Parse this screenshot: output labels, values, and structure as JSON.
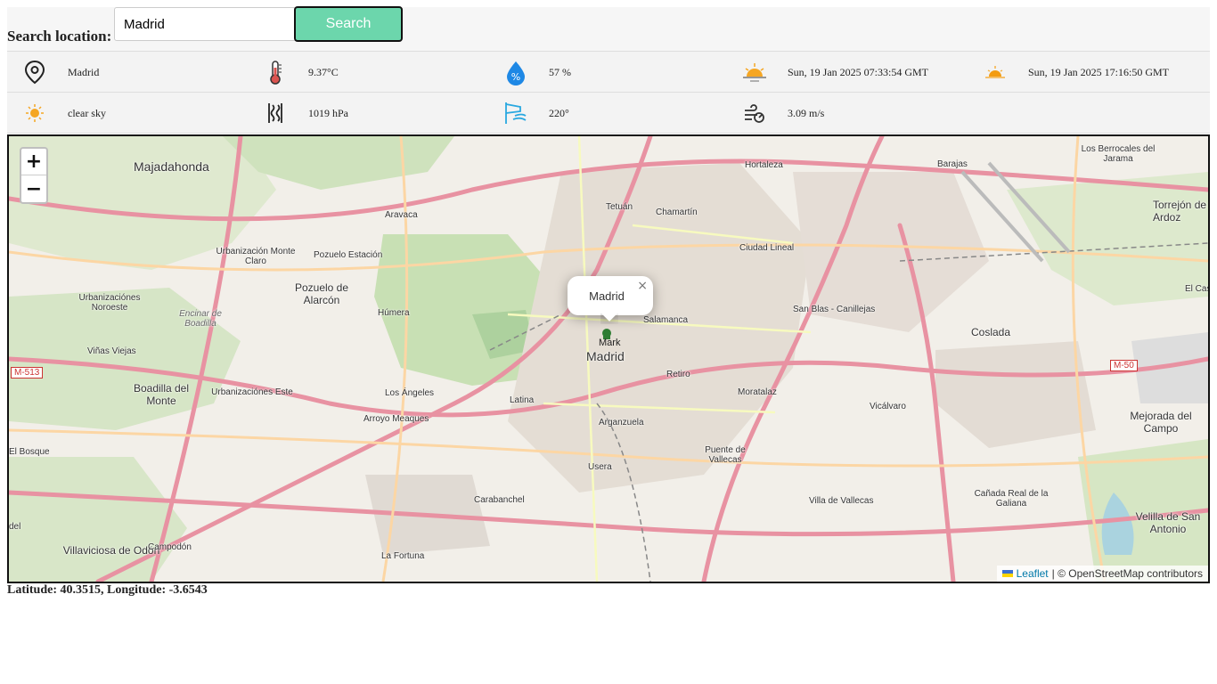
{
  "search": {
    "label": "Search location:",
    "value": "Madrid",
    "button_label": "Search"
  },
  "weather": {
    "location": "Madrid",
    "temperature": "9.37°C",
    "humidity": "57 %",
    "sunrise": "Sun, 19 Jan 2025 07:33:54 GMT",
    "sunset": "Sun, 19 Jan 2025 17:16:50 GMT",
    "description": "clear sky",
    "pressure": "1019 hPa",
    "wind_direction": "220°",
    "wind_speed": "3.09 m/s"
  },
  "icons": {
    "location": "location-pin-icon",
    "temperature": "thermometer-icon",
    "humidity": "humidity-icon",
    "sunrise": "sunrise-icon",
    "sunset": "sunset-icon",
    "description": "sun-icon",
    "pressure": "pressure-icon",
    "wind_direction": "wind-direction-icon",
    "wind_speed": "wind-speed-icon"
  },
  "map": {
    "zoom_in": "+",
    "zoom_out": "−",
    "popup_text": "Madrid",
    "popup_close": "×",
    "marker_label": "Mark",
    "attribution_leaflet": "Leaflet",
    "attribution_rest": "| © OpenStreetMap contributors",
    "places": {
      "majadahonda": "Majadahonda",
      "tetuan": "Tetuán",
      "chamartin": "Chamartín",
      "hortaleza": "Hortaleza",
      "barajas": "Barajas",
      "los_berrocales": "Los Berrocales del Jarama",
      "torrejon": "Torrejón de Ardoz",
      "aravaca": "Aravaca",
      "urb_monte_claro": "Urbanización Monte Claro",
      "pozuelo_estacion": "Pozuelo Estación",
      "ciudad_lineal": "Ciudad Lineal",
      "pozuelo": "Pozuelo de Alarcón",
      "urb_noroeste": "Urbanizaciónes Noroeste",
      "encinar": "Encinar de Boadilla",
      "humera": "Húmera",
      "salamanca": "Salamanca",
      "san_blas": "San Blas - Canillejas",
      "coslada": "Coslada",
      "madrid": "Madrid",
      "vinas_viejas": "Viñas Viejas",
      "retiro": "Retiro",
      "boadilla": "Boadilla del Monte",
      "urb_este": "Urbanizaciónes Este",
      "los_angeles": "Los Ángeles",
      "latina": "Latina",
      "moratalaz": "Moratalaz",
      "vicalvaro": "Vicálvaro",
      "arroyo_meaques": "Arroyo Meaques",
      "arganzuela": "Arganzuela",
      "mejorada": "Mejorada del Campo",
      "el_bosque": "El Bosque",
      "puente_vallecas": "Puente de Vallecas",
      "usera": "Usera",
      "carabanchel": "Carabanchel",
      "villa_vallecas": "Villa de Vallecas",
      "canada_real": "Cañada Real de la Galiana",
      "velilla": "Velilla de San Antonio",
      "villaviciosa": "Villaviciosa de Odón",
      "campodon": "Campodón",
      "la_fortuna": "La Fortuna",
      "del": "del",
      "el_cas": "El Cas",
      "m513": "M-513",
      "m50": "M-50"
    }
  },
  "coordinates": "Latitude: 40.3515, Longitude: -3.6543"
}
